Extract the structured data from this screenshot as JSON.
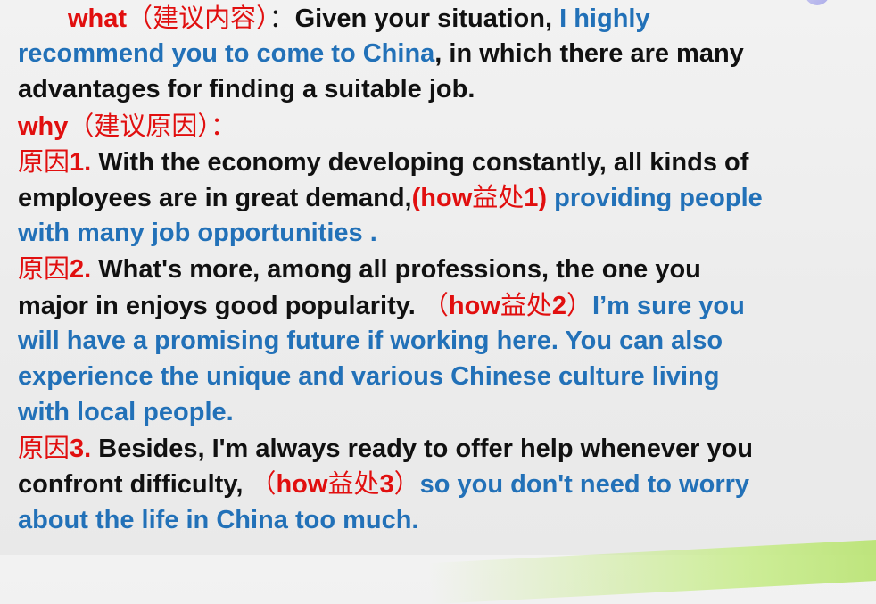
{
  "colors": {
    "label_red": "#e10f0f",
    "text_black": "#111111",
    "text_blue": "#2271b8",
    "background": "#ececec"
  },
  "lines": [
    {
      "segs": [
        {
          "t": "what",
          "c": "red"
        },
        {
          "t": "（建议内容）",
          "c": "red",
          "cn": true
        },
        {
          "t": "：",
          "c": "black",
          "cn": true
        },
        {
          "t": "Given your situation, ",
          "c": "black"
        },
        {
          "t": "I highly",
          "c": "blue"
        }
      ]
    },
    {
      "segs": [
        {
          "t": "recommend you to come to China",
          "c": "blue"
        },
        {
          "t": ", in which there are many",
          "c": "black"
        }
      ]
    },
    {
      "segs": [
        {
          "t": "advantages for finding a suitable job.",
          "c": "black"
        }
      ]
    },
    {
      "segs": [
        {
          "t": "why",
          "c": "red"
        },
        {
          "t": "（建议原因）",
          "c": "red",
          "cn": true
        },
        {
          "t": "：",
          "c": "red",
          "cn": true
        }
      ]
    },
    {
      "segs": [
        {
          "t": "原因",
          "c": "red",
          "cn": true
        },
        {
          "t": "1.",
          "c": "red"
        },
        {
          "t": " With the economy developing constantly, all kinds of",
          "c": "black"
        }
      ]
    },
    {
      "segs": [
        {
          "t": "employees are in great demand,",
          "c": "black"
        },
        {
          "t": "(how",
          "c": "red"
        },
        {
          "t": "益处",
          "c": "red",
          "cn": true
        },
        {
          "t": "1)",
          "c": "red"
        },
        {
          "t": " providing people",
          "c": "blue"
        }
      ]
    },
    {
      "segs": [
        {
          "t": "with many job opportunities .",
          "c": "blue"
        }
      ]
    },
    {
      "segs": [
        {
          "t": "原因",
          "c": "red",
          "cn": true
        },
        {
          "t": "2.",
          "c": "red"
        },
        {
          "t": "  What's more, among all professions, the one you",
          "c": "black"
        }
      ]
    },
    {
      "segs": [
        {
          "t": "major in enjoys good popularity. ",
          "c": "black"
        },
        {
          "t": "（",
          "c": "red",
          "cn": true
        },
        {
          "t": "how",
          "c": "red"
        },
        {
          "t": "益处",
          "c": "red",
          "cn": true
        },
        {
          "t": "2",
          "c": "red"
        },
        {
          "t": "）",
          "c": "red",
          "cn": true
        },
        {
          "t": "I’m sure you",
          "c": "blue"
        }
      ]
    },
    {
      "segs": [
        {
          "t": "will have a promising future if working here. You can also",
          "c": "blue"
        }
      ]
    },
    {
      "segs": [
        {
          "t": "experience the unique and various Chinese culture living",
          "c": "blue"
        }
      ]
    },
    {
      "segs": [
        {
          "t": "with local people.",
          "c": "blue"
        }
      ]
    },
    {
      "segs": [
        {
          "t": "原因",
          "c": "red",
          "cn": true
        },
        {
          "t": "3.",
          "c": "red"
        },
        {
          "t": " Besides, I'm always ready to offer help whenever you",
          "c": "black"
        }
      ]
    },
    {
      "segs": [
        {
          "t": "confront difficulty, ",
          "c": "black"
        },
        {
          "t": "（",
          "c": "red",
          "cn": true
        },
        {
          "t": "how",
          "c": "red"
        },
        {
          "t": "益处",
          "c": "red",
          "cn": true
        },
        {
          "t": "3",
          "c": "red"
        },
        {
          "t": "）",
          "c": "red",
          "cn": true
        },
        {
          "t": "so you don't need to worry",
          "c": "blue"
        }
      ]
    },
    {
      "segs": [
        {
          "t": "about the life in China too much.",
          "c": "blue"
        }
      ]
    }
  ]
}
